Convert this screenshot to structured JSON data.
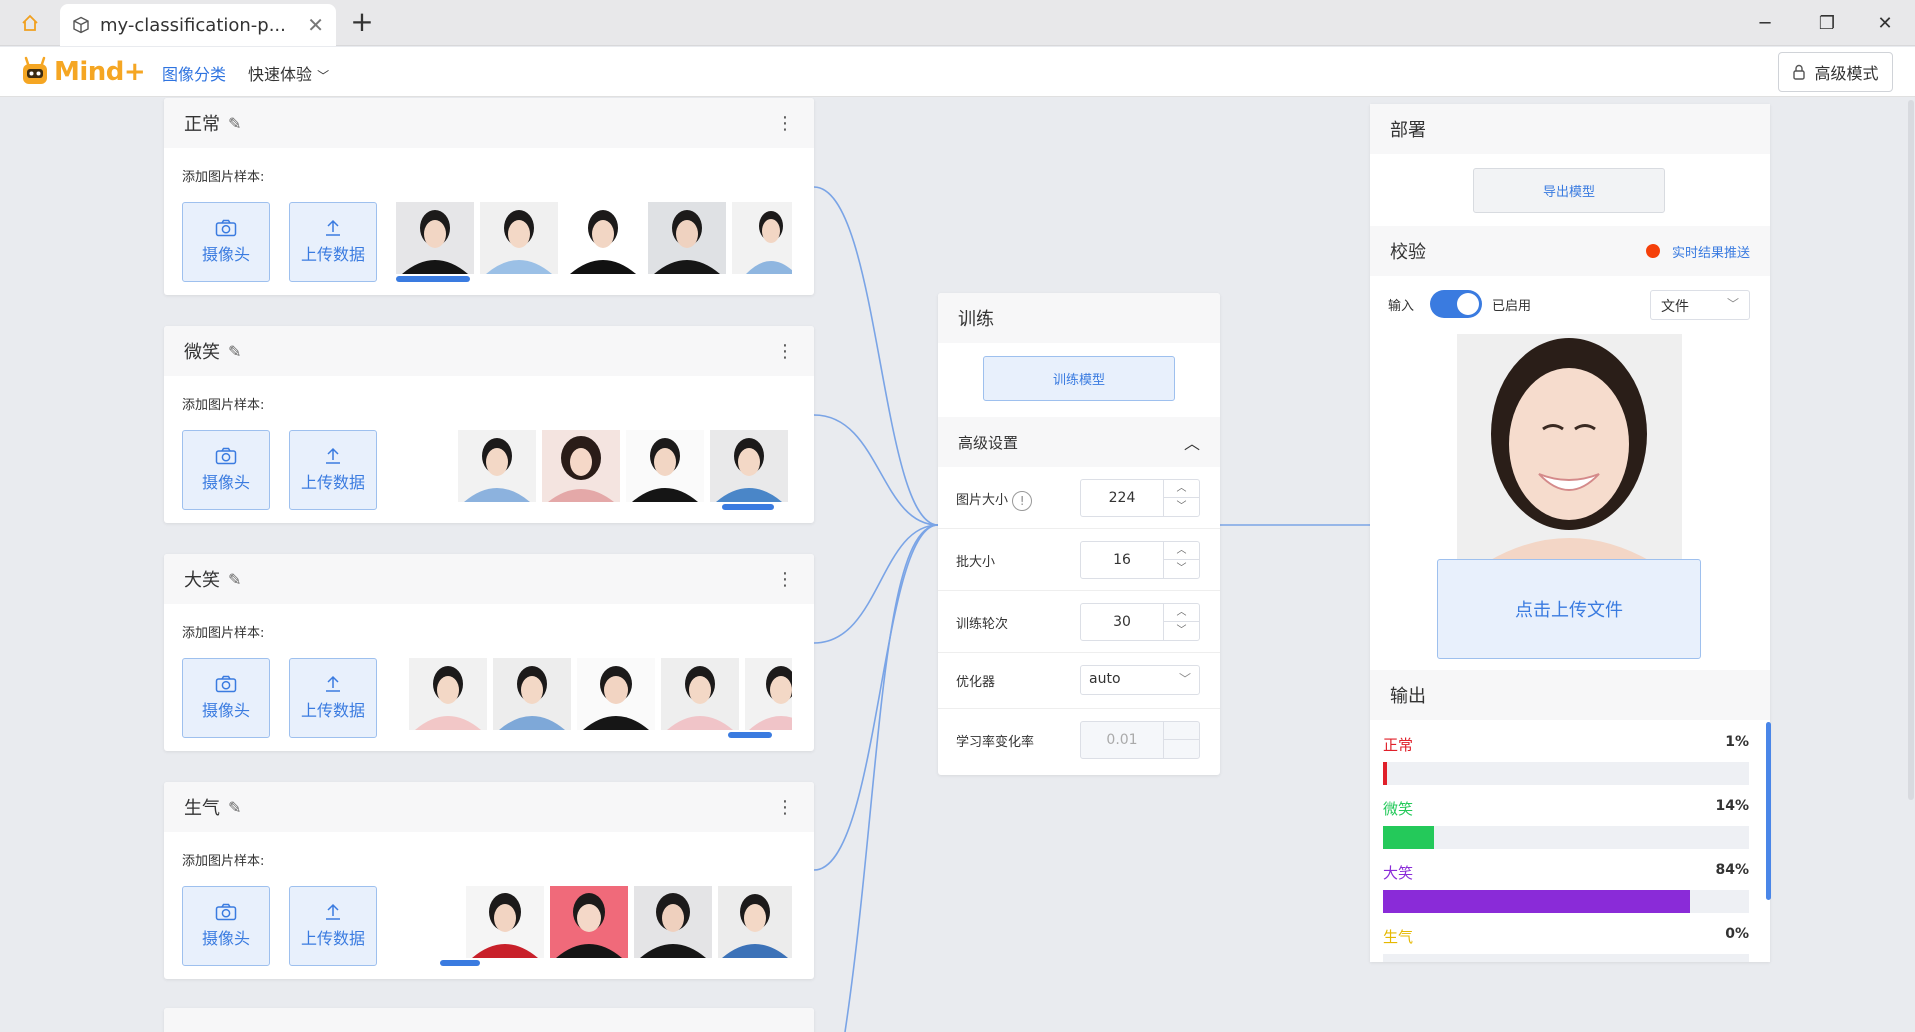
{
  "window": {
    "tab_title": "my-classification-p...",
    "close_symbol": "✕",
    "new_tab_symbol": "+",
    "minimize_symbol": "─",
    "restore_symbol": "❐",
    "close_window_symbol": "✕"
  },
  "menu": {
    "logo_text": "Mind+",
    "image_classification": "图像分类",
    "quick_experience": "快速体验",
    "advanced_mode": "高级模式"
  },
  "classes": [
    {
      "title": "正常",
      "add_label": "添加图片样本:",
      "camera": "摄像头",
      "upload": "上传数据"
    },
    {
      "title": "微笑",
      "add_label": "添加图片样本:",
      "camera": "摄像头",
      "upload": "上传数据"
    },
    {
      "title": "大笑",
      "add_label": "添加图片样本:",
      "camera": "摄像头",
      "upload": "上传数据"
    },
    {
      "title": "生气",
      "add_label": "添加图片样本:",
      "camera": "摄像头",
      "upload": "上传数据"
    }
  ],
  "train": {
    "title": "训练",
    "train_button": "训练模型",
    "advanced": "高级设置",
    "params": [
      {
        "label": "图片大小",
        "value": "224"
      },
      {
        "label": "批大小",
        "value": "16"
      },
      {
        "label": "训练轮次",
        "value": "30"
      },
      {
        "label": "优化器",
        "value": "auto"
      },
      {
        "label": "学习率变化率",
        "value": "0.01"
      }
    ]
  },
  "deploy": {
    "title": "部署",
    "export_button": "导出模型"
  },
  "verify": {
    "title": "校验",
    "push_label": "实时结果推送",
    "input_label": "输入",
    "enabled_label": "已启用",
    "source_value": "文件",
    "upload_file": "点击上传文件"
  },
  "output": {
    "title": "输出",
    "rows": [
      {
        "name": "正常",
        "pct": "1%",
        "value": 0.01,
        "color": "#e0202a"
      },
      {
        "name": "微笑",
        "pct": "14%",
        "value": 0.14,
        "color": "#24c95a"
      },
      {
        "name": "大笑",
        "pct": "84%",
        "value": 0.84,
        "color": "#8a2bd8"
      },
      {
        "name": "生气",
        "pct": "0%",
        "value": 0.0,
        "color": "#e5b800"
      }
    ]
  },
  "colors": {
    "accent": "#3a7be0",
    "wire": "#7aa4e6"
  }
}
